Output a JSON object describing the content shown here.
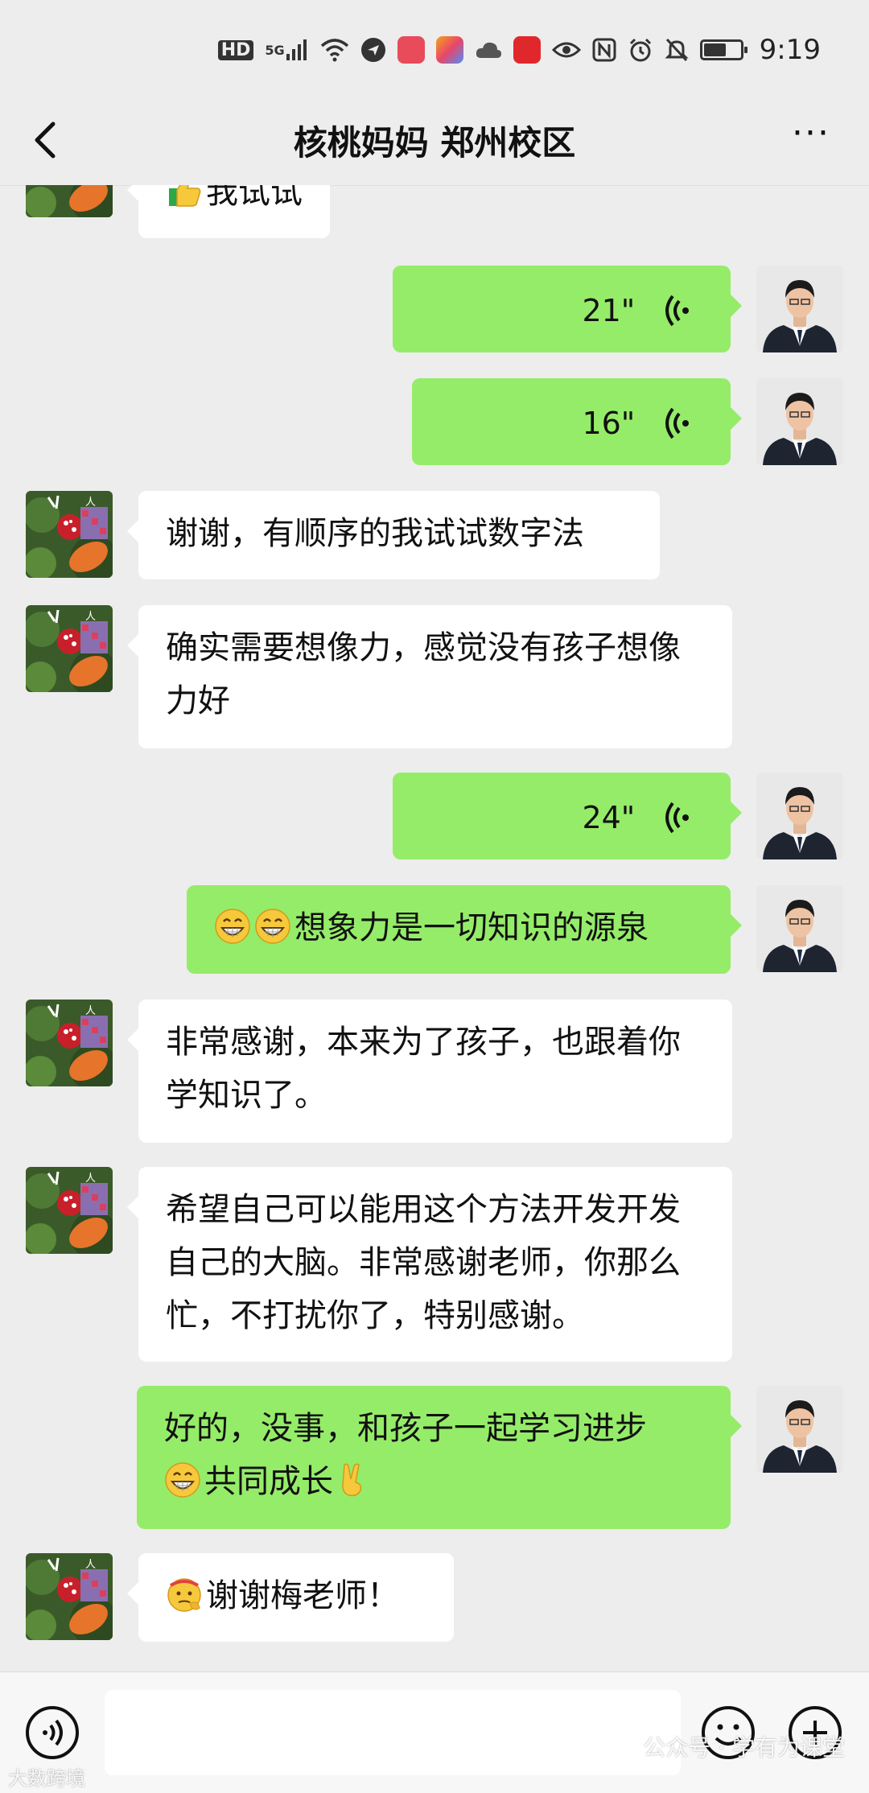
{
  "status_bar": {
    "hd_label": "HD",
    "signal_label": "5G",
    "time": "9:19",
    "icons": [
      "hd-icon",
      "signal-5g-icon",
      "wifi-icon",
      "send-icon",
      "app-red-icon",
      "app-colorful-icon",
      "cloud-icon",
      "chart-icon",
      "eye-icon",
      "nfc-icon",
      "alarm-icon",
      "mute-icon",
      "battery-icon"
    ]
  },
  "header": {
    "title": "核桃妈妈 郑州校区",
    "back_icon": "chevron-left-icon",
    "more_label": "···"
  },
  "messages": [
    {
      "side": "in",
      "type": "text",
      "emoji": "thumbs-up-icon",
      "text": "我试试"
    },
    {
      "side": "out",
      "type": "voice",
      "duration": "21\""
    },
    {
      "side": "out",
      "type": "voice",
      "duration": "16\""
    },
    {
      "side": "in",
      "type": "text",
      "text": "谢谢，有顺序的我试试数字法"
    },
    {
      "side": "in",
      "type": "text",
      "text": "确实需要想像力，感觉没有孩子想像力好"
    },
    {
      "side": "out",
      "type": "voice",
      "duration": "24\""
    },
    {
      "side": "out",
      "type": "text",
      "emoji": "grin-icon",
      "text": "想象力是一切知识的源泉"
    },
    {
      "side": "in",
      "type": "text",
      "text": "非常感谢，本来为了孩子，也跟着你学知识了。"
    },
    {
      "side": "in",
      "type": "text",
      "text": "希望自己可以能用这个方法开发开发自己的大脑。非常感谢老师，你那么忙，不打扰你了，特别感谢。"
    },
    {
      "side": "out",
      "type": "text",
      "text_line1": "好的，没事，和孩子一起学习进步",
      "text_line2": "共同成长",
      "emoji": "grin-icon",
      "emoji_end": "victory-hand-icon"
    },
    {
      "side": "in",
      "type": "text",
      "emoji": "thinking-face-icon",
      "text": "谢谢梅老师！"
    }
  ],
  "bottom_bar": {
    "input_value": "",
    "voice_icon": "voice-mode-icon",
    "emoji_icon": "emoji-icon",
    "plus_icon": "plus-icon"
  },
  "watermarks": {
    "right": "公众号 · 学有为课堂",
    "left": "大数跨境"
  },
  "colors": {
    "background": "#ededed",
    "outgoing_bubble": "#95ec69",
    "incoming_bubble": "#ffffff"
  }
}
